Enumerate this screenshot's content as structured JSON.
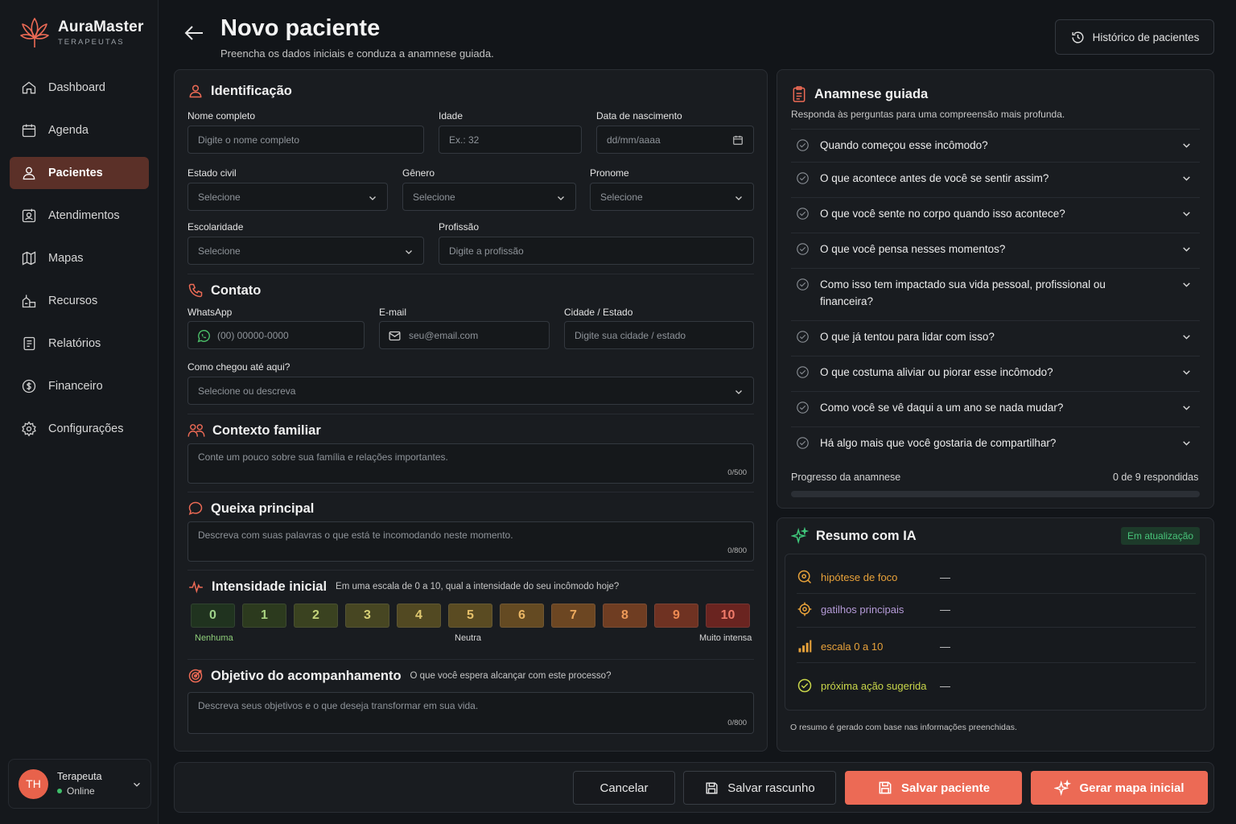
{
  "app": {
    "name": "AuraMaster",
    "subtitle": "TERAPEUTAS"
  },
  "sidebar": {
    "items": [
      {
        "label": "Dashboard",
        "icon": "home-icon"
      },
      {
        "label": "Agenda",
        "icon": "calendar-icon"
      },
      {
        "label": "Pacientes",
        "icon": "user-icon",
        "active": true
      },
      {
        "label": "Atendimentos",
        "icon": "session-icon"
      },
      {
        "label": "Mapas",
        "icon": "map-icon"
      },
      {
        "label": "Recursos",
        "icon": "resources-icon"
      },
      {
        "label": "Relatórios",
        "icon": "report-icon"
      },
      {
        "label": "Financeiro",
        "icon": "dollar-icon"
      },
      {
        "label": "Configurações",
        "icon": "gear-icon"
      }
    ],
    "user": {
      "initials": "TH",
      "name": "Terapeuta",
      "status": "Online"
    }
  },
  "header": {
    "title": "Novo paciente",
    "subtitle": "Preencha os dados iniciais e conduza a anamnese guiada.",
    "history_button": "Histórico de pacientes"
  },
  "identificacao": {
    "title": "Identificação",
    "nome": {
      "label": "Nome completo",
      "placeholder": "Digite o nome completo"
    },
    "idade": {
      "label": "Idade",
      "placeholder": "Ex.: 32"
    },
    "nascimento": {
      "label": "Data de nascimento",
      "placeholder": "dd/mm/aaaa"
    },
    "estado_civil": {
      "label": "Estado civil",
      "value": "Selecione"
    },
    "genero": {
      "label": "Gênero",
      "value": "Selecione"
    },
    "pronome": {
      "label": "Pronome",
      "value": "Selecione"
    },
    "escolaridade": {
      "label": "Escolaridade",
      "value": "Selecione"
    },
    "profissao": {
      "label": "Profissão",
      "placeholder": "Digite a profissão"
    }
  },
  "contato": {
    "title": "Contato",
    "whatsapp": {
      "label": "WhatsApp",
      "placeholder": "(00) 00000-0000"
    },
    "email": {
      "label": "E-mail",
      "placeholder": "seu@email.com"
    },
    "cidade": {
      "label": "Cidade / Estado",
      "placeholder": "Digite sua cidade / estado"
    },
    "origem": {
      "label": "Como chegou até aqui?",
      "value": "Selecione ou descreva"
    }
  },
  "contexto": {
    "title": "Contexto familiar",
    "placeholder": "Conte um pouco sobre sua família e relações importantes.",
    "count": "0/500"
  },
  "queixa": {
    "title": "Queixa principal",
    "placeholder": "Descreva com suas palavras o que está te incomodando neste momento.",
    "count": "0/800"
  },
  "intensidade": {
    "title": "Intensidade inicial",
    "hint": "Em uma escala de 0 a 10, qual a intensidade do seu incômodo hoje?",
    "values": [
      "0",
      "1",
      "2",
      "3",
      "4",
      "5",
      "6",
      "7",
      "8",
      "9",
      "10"
    ],
    "colors": [
      "#20331f",
      "#2c3a1e",
      "#3a4220",
      "#474622",
      "#524922",
      "#5a4b22",
      "#644a22",
      "#6c4622",
      "#6f3d22",
      "#6f3222",
      "#6a2420"
    ],
    "text_colors": [
      "#9fd38a",
      "#a9d380",
      "#c3d27a",
      "#d6cf75",
      "#dfc870",
      "#e6c06a",
      "#eab664",
      "#edaa5e",
      "#ee9a58",
      "#ee8a52",
      "#f07b6a"
    ],
    "label_min": "Nenhuma",
    "label_mid": "Neutra",
    "label_max": "Muito intensa"
  },
  "objetivo": {
    "title": "Objetivo do acompanhamento",
    "hint": "O que você espera alcançar com este processo?",
    "placeholder": "Descreva seus objetivos e o que deseja transformar em sua vida.",
    "count": "0/800"
  },
  "anamnese": {
    "title": "Anamnese guiada",
    "subtitle": "Responda às perguntas para uma compreensão mais profunda.",
    "questions": [
      "Quando começou esse incômodo?",
      "O que acontece antes de você se sentir assim?",
      "O que você sente no corpo quando isso acontece?",
      "O que você pensa nesses momentos?",
      "Como isso tem impactado sua vida pessoal, profissional ou financeira?",
      "O que já tentou para lidar com isso?",
      "O que costuma aliviar ou piorar esse incômodo?",
      "Como você se vê daqui a um ano se nada mudar?",
      "Há algo mais que você gostaria de compartilhar?"
    ],
    "progress_label": "Progresso da anamnese",
    "progress_count": "0 de 9 respondidas",
    "progress_fraction": 0
  },
  "resumo": {
    "title": "Resumo com IA",
    "badge": "Em atualização",
    "rows": [
      {
        "label": "hipótese de foco",
        "value": "—",
        "color": "#e8a23a"
      },
      {
        "label": "gatilhos principais",
        "value": "—",
        "color": "#b59bd8"
      },
      {
        "label": "escala 0 a 10",
        "value": "—",
        "color": "#e8a23a"
      },
      {
        "label": "próxima ação sugerida",
        "value": "—",
        "color": "#c9d64a"
      }
    ],
    "note": "O resumo é gerado com base nas informações preenchidas."
  },
  "actions": {
    "cancel": "Cancelar",
    "draft": "Salvar rascunho",
    "save": "Salvar paciente",
    "generate": "Gerar mapa inicial"
  },
  "theme": {
    "accent": "#ec6a55",
    "active_nav": "#5b3028"
  }
}
